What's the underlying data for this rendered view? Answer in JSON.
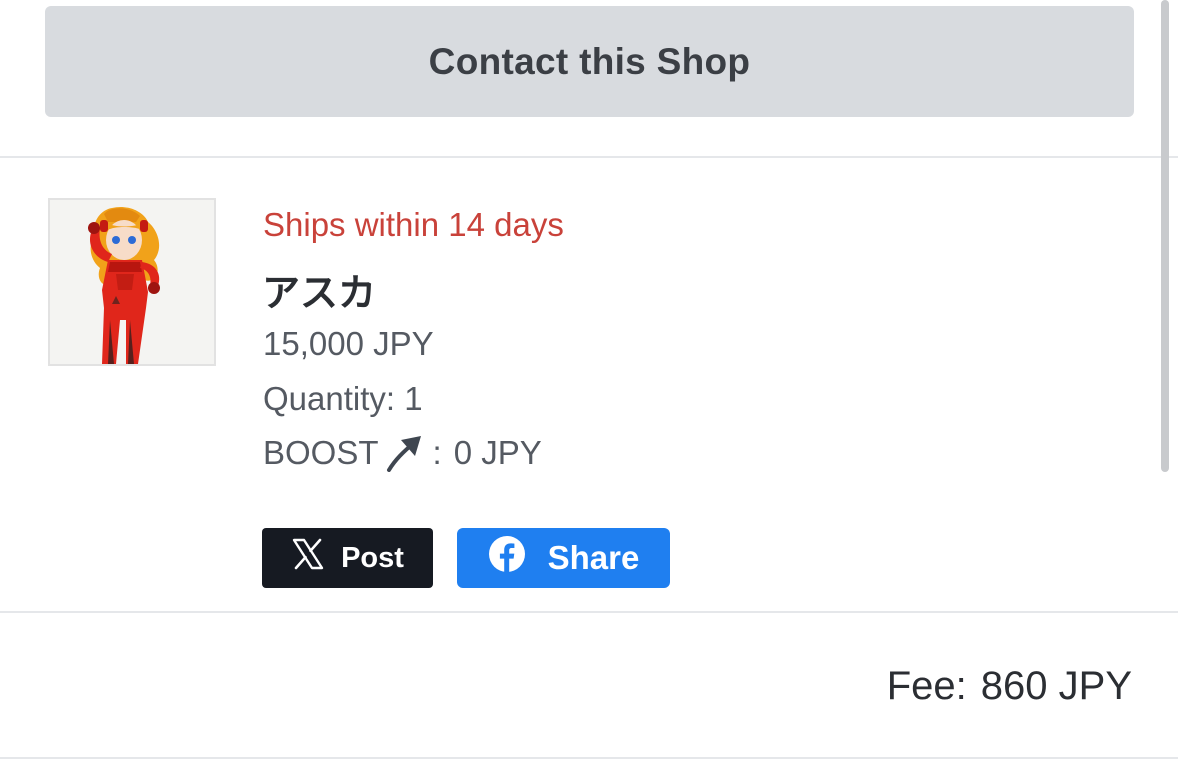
{
  "contact": {
    "label": "Contact this Shop"
  },
  "item": {
    "shipping": "Ships within 14 days",
    "title": "アスカ",
    "price": "15,000 JPY",
    "quantity_label": "Quantity:",
    "quantity_value": "1",
    "boost_label": "BOOST",
    "boost_separator": ":",
    "boost_value": "0 JPY",
    "image_icon": "figure-thumbnail"
  },
  "share": {
    "post_label": "Post",
    "post_icon": "x-logo-icon",
    "share_label": "Share",
    "share_icon": "facebook-logo-icon"
  },
  "fee": {
    "label": "Fee:",
    "value": "860 JPY"
  },
  "colors": {
    "shipping_red": "#c9423a",
    "x_black": "#161a22",
    "facebook_blue": "#1f7ff0",
    "contact_gray": "#d8dbdf"
  }
}
